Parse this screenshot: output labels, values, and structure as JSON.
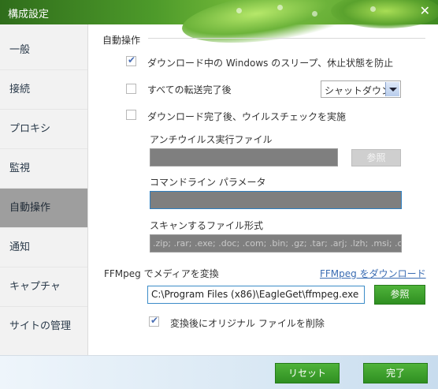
{
  "window": {
    "title": "構成設定"
  },
  "sidebar": {
    "items": [
      {
        "label": "一般"
      },
      {
        "label": "接続"
      },
      {
        "label": "プロキシ"
      },
      {
        "label": "監視"
      },
      {
        "label": "自動操作",
        "active": true
      },
      {
        "label": "通知"
      },
      {
        "label": "キャプチャ"
      },
      {
        "label": "サイトの管理"
      }
    ]
  },
  "auto": {
    "section_title": "自動操作",
    "prevent_sleep": {
      "label": "ダウンロード中の Windows のスリープ、休止状態を防止",
      "checked": true
    },
    "after_all_transfers": {
      "label": "すべての転送完了後",
      "checked": false
    },
    "after_action_select": {
      "value": "シャットダウン"
    },
    "virus_check": {
      "label": "ダウンロード完了後、ウイルスチェックを実施",
      "checked": false
    },
    "antivirus_file_label": "アンチウイルス実行ファイル",
    "antivirus_file_value": "",
    "browse_label": "参照",
    "cmdline_label": "コマンドライン パラメータ",
    "cmdline_value": "",
    "scan_types_label": "スキャンするファイル形式",
    "scan_types_value": ".zip; .rar; .exe; .doc; .com; .bin; .gz; .tar; .arj; .lzh; .msi; .cab"
  },
  "ffmpeg": {
    "label": "FFMpeg でメディアを変換",
    "download_link": "FFMpeg をダウンロード",
    "path_value": "C:\\Program Files (x86)\\EagleGet\\ffmpeg.exe",
    "browse_label": "参照",
    "delete_original": {
      "label": "変換後にオリジナル ファイルを削除",
      "checked": true
    }
  },
  "footer": {
    "reset_label": "リセット",
    "done_label": "完了"
  },
  "colors": {
    "accent_green": "#3aa12a",
    "link_blue": "#3b6db3",
    "sidebar_active": "#9e9e9e"
  }
}
